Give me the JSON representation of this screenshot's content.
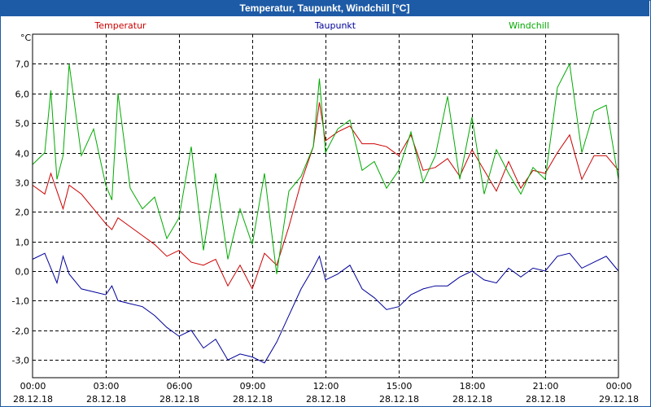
{
  "window": {
    "title": "Temperatur, Taupunkt, Windchill [°C]"
  },
  "chart_data": {
    "type": "line",
    "title": "Temperatur, Taupunkt, Windchill [°C]",
    "ylabel": "°C",
    "xlabel": "",
    "ylim": [
      -3.6,
      8.0
    ],
    "yticks": [
      7.0,
      6.0,
      5.0,
      4.0,
      3.0,
      2.0,
      1.0,
      0.0,
      -1.0,
      -2.0,
      -3.0
    ],
    "ytick_labels": [
      "7,0",
      "6,0",
      "5,0",
      "4,0",
      "3,0",
      "2,0",
      "1,0",
      "0,0",
      "-1,0",
      "-2,0",
      "-3,0"
    ],
    "xlim": [
      "28.12.18 00:00",
      "29.12.18 00:00"
    ],
    "xticks": [
      {
        "time": "00:00",
        "date": "28.12.18"
      },
      {
        "time": "03:00",
        "date": "28.12.18"
      },
      {
        "time": "06:00",
        "date": "28.12.18"
      },
      {
        "time": "09:00",
        "date": "28.12.18"
      },
      {
        "time": "12:00",
        "date": "28.12.18"
      },
      {
        "time": "15:00",
        "date": "28.12.18"
      },
      {
        "time": "18:00",
        "date": "28.12.18"
      },
      {
        "time": "21:00",
        "date": "28.12.18"
      },
      {
        "time": "00:00",
        "date": "29.12.18"
      }
    ],
    "grid": true,
    "legend": "top",
    "x_hours": [
      0,
      0.5,
      0.75,
      1.0,
      1.25,
      1.5,
      2.0,
      2.5,
      3.0,
      3.25,
      3.5,
      4.0,
      4.5,
      5.0,
      5.5,
      6.0,
      6.5,
      7.0,
      7.5,
      8.0,
      8.5,
      9.0,
      9.5,
      10.0,
      10.5,
      11.0,
      11.5,
      11.75,
      12.0,
      12.5,
      13.0,
      13.5,
      14.0,
      14.5,
      15.0,
      15.5,
      16.0,
      16.5,
      17.0,
      17.5,
      18.0,
      18.5,
      19.0,
      19.5,
      20.0,
      20.5,
      21.0,
      21.5,
      22.0,
      22.5,
      23.0,
      23.5,
      24.0
    ],
    "series": [
      {
        "name": "Temperatur",
        "color": "#cc0000",
        "values": [
          2.9,
          2.6,
          3.3,
          2.7,
          2.1,
          2.9,
          2.6,
          2.1,
          1.6,
          1.4,
          1.8,
          1.5,
          1.2,
          0.9,
          0.5,
          0.7,
          0.3,
          0.2,
          0.4,
          -0.5,
          0.2,
          -0.6,
          0.6,
          0.2,
          1.5,
          3.0,
          4.2,
          5.7,
          4.4,
          4.7,
          4.9,
          4.3,
          4.3,
          4.2,
          3.9,
          4.6,
          3.4,
          3.5,
          3.8,
          3.2,
          4.1,
          3.4,
          2.7,
          3.7,
          2.8,
          3.4,
          3.3,
          4.0,
          4.6,
          3.1,
          3.9,
          3.9,
          3.4
        ]
      },
      {
        "name": "Taupunkt",
        "color": "#000099",
        "values": [
          0.4,
          0.6,
          0.1,
          -0.4,
          0.5,
          -0.1,
          -0.6,
          -0.7,
          -0.8,
          -0.5,
          -1.0,
          -1.1,
          -1.2,
          -1.5,
          -1.9,
          -2.2,
          -2.0,
          -2.6,
          -2.3,
          -3.0,
          -2.8,
          -2.9,
          -3.1,
          -2.4,
          -1.5,
          -0.6,
          0.1,
          0.5,
          -0.3,
          -0.1,
          0.2,
          -0.6,
          -0.9,
          -1.3,
          -1.2,
          -0.8,
          -0.6,
          -0.5,
          -0.5,
          -0.2,
          0.0,
          -0.3,
          -0.4,
          0.1,
          -0.2,
          0.1,
          0.0,
          0.5,
          0.6,
          0.1,
          0.3,
          0.5,
          0.0
        ]
      },
      {
        "name": "Windchill",
        "color": "#00aa00",
        "values": [
          3.6,
          4.0,
          6.1,
          3.1,
          3.9,
          7.0,
          3.9,
          4.8,
          2.9,
          2.4,
          6.0,
          2.8,
          2.1,
          2.5,
          1.1,
          1.8,
          4.2,
          0.7,
          3.3,
          0.4,
          2.1,
          0.9,
          3.3,
          -0.1,
          2.7,
          3.2,
          4.2,
          6.5,
          4.0,
          4.8,
          5.1,
          3.4,
          3.7,
          2.8,
          3.4,
          4.7,
          3.0,
          3.9,
          5.9,
          3.1,
          5.2,
          2.6,
          4.1,
          3.3,
          2.6,
          3.5,
          3.1,
          6.2,
          7.0,
          4.0,
          5.4,
          5.6,
          3.1
        ]
      }
    ]
  }
}
